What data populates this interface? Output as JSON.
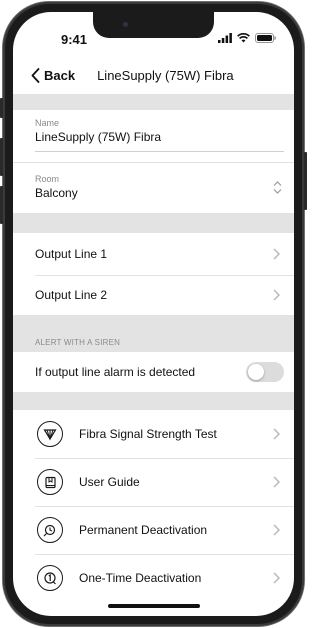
{
  "status_bar": {
    "time": "9:41"
  },
  "nav": {
    "back_label": "Back",
    "title": "LineSupply (75W) Fibra"
  },
  "fields": {
    "name": {
      "label": "Name",
      "value": "LineSupply (75W) Fibra"
    },
    "room": {
      "label": "Room",
      "value": "Balcony"
    }
  },
  "outputs": [
    {
      "label": "Output Line 1"
    },
    {
      "label": "Output Line 2"
    }
  ],
  "siren_section": {
    "caption": "ALERT WITH A SIREN",
    "toggle_label": "If output line alarm is detected",
    "toggle_on": false
  },
  "actions": [
    {
      "label": "Fibra Signal Strength Test",
      "icon": "signal-test-icon"
    },
    {
      "label": "User Guide",
      "icon": "book-icon"
    },
    {
      "label": "Permanent Deactivation",
      "icon": "permanent-deactivation-icon"
    },
    {
      "label": "One-Time Deactivation",
      "icon": "one-time-deactivation-icon"
    }
  ],
  "colors": {
    "separator": "#e3e3e3",
    "toggle_off": "#dcdcdc",
    "text": "#111111",
    "caption": "#8a8a8a"
  }
}
